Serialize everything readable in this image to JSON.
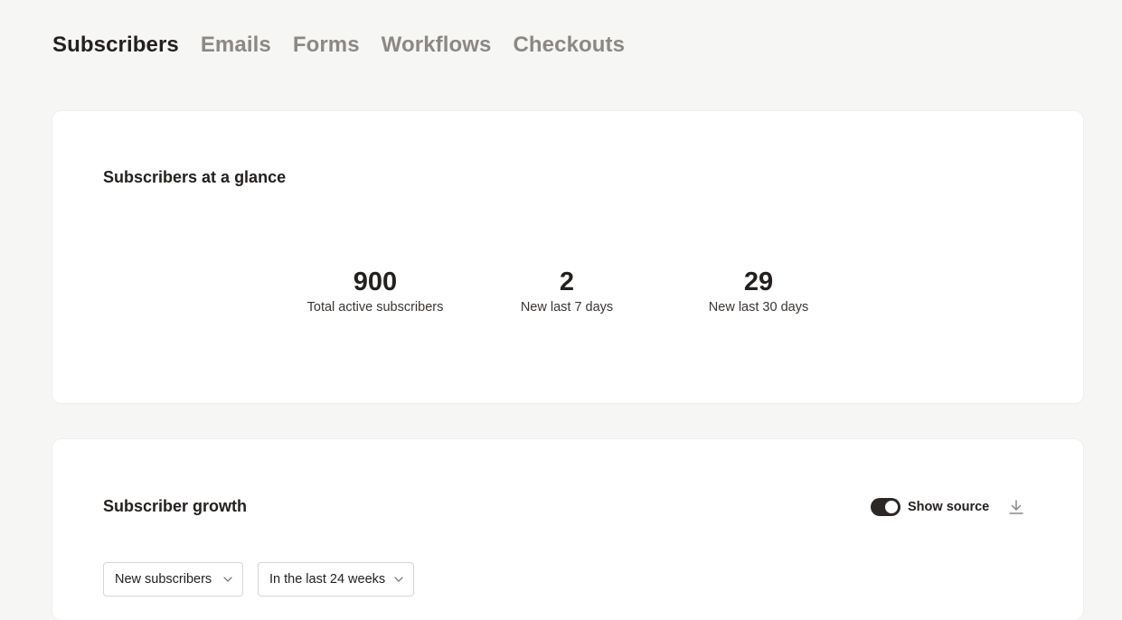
{
  "tabs": [
    {
      "label": "Subscribers",
      "active": true
    },
    {
      "label": "Emails",
      "active": false
    },
    {
      "label": "Forms",
      "active": false
    },
    {
      "label": "Workflows",
      "active": false
    },
    {
      "label": "Checkouts",
      "active": false
    }
  ],
  "glance": {
    "title": "Subscribers at a glance",
    "stats": [
      {
        "value": "900",
        "label": "Total active subscribers"
      },
      {
        "value": "2",
        "label": "New last 7 days"
      },
      {
        "value": "29",
        "label": "New last 30 days"
      }
    ]
  },
  "growth": {
    "title": "Subscriber growth",
    "toggle": {
      "label": "Show source",
      "on": true
    },
    "download_icon": "download-icon",
    "filters": {
      "metric": {
        "value": "New subscribers",
        "icon": "chevron-down-icon"
      },
      "range": {
        "value": "In the last 24 weeks",
        "icon": "chevron-down-icon"
      }
    }
  },
  "colors": {
    "background": "#f6f6f5",
    "card": "#ffffff",
    "text": "#24201e",
    "inactive_tab": "#8c8884",
    "toggle_on": "#2c2826"
  }
}
